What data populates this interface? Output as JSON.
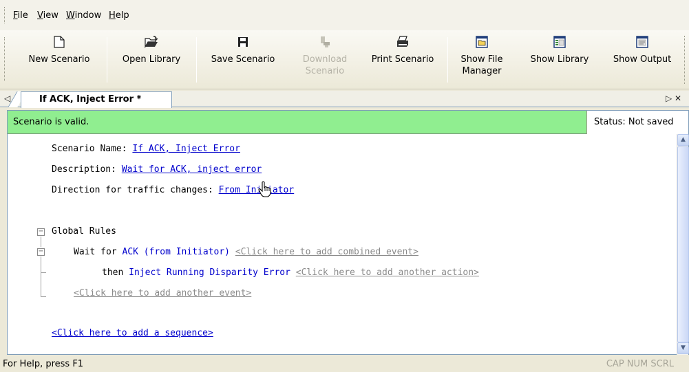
{
  "menu": {
    "items": [
      {
        "label": "File",
        "accel": "F",
        "rest": "ile"
      },
      {
        "label": "View",
        "accel": "V",
        "rest": "iew"
      },
      {
        "label": "Window",
        "accel": "W",
        "rest": "indow"
      },
      {
        "label": "Help",
        "accel": "H",
        "rest": "elp"
      }
    ]
  },
  "toolbar": {
    "new_scenario": {
      "line1": "New Scenario",
      "icon": "new-document-icon"
    },
    "open_library": {
      "line1": "Open Library",
      "icon": "open-folder-icon"
    },
    "save_scenario": {
      "line1": "Save Scenario",
      "icon": "floppy-disk-icon"
    },
    "download_scenario": {
      "line1": "Download",
      "line2": "Scenario",
      "icon": "download-icon",
      "enabled": false
    },
    "print_scenario": {
      "line1": "Print Scenario",
      "icon": "printer-icon"
    },
    "show_file_manager": {
      "line1": "Show File",
      "line2": "Manager",
      "icon": "file-manager-icon"
    },
    "show_library": {
      "line1": "Show Library",
      "icon": "library-icon"
    },
    "show_output": {
      "line1": "Show Output",
      "icon": "output-window-icon"
    }
  },
  "tabs": {
    "left_arrow": "◁",
    "right_arrows": "▷ ✕",
    "active_tab": "If ACK, Inject Error *"
  },
  "validation": {
    "message": "Scenario is valid.",
    "status": "Status: Not saved",
    "color": "#90ee90"
  },
  "editor": {
    "scenario_name_label": "Scenario Name:",
    "scenario_name_value": "If ACK, Inject Error",
    "description_label": "Description:",
    "description_value": "Wait for ACK, inject error",
    "direction_label": "Direction for traffic changes:",
    "direction_value": "From Initiator",
    "global_rules_label": "Global Rules",
    "wait_for_label": "Wait for",
    "wait_for_event": "ACK (from Initiator)",
    "add_combined_event": "<Click here to add combined event>",
    "then_label": "then",
    "action": "Inject Running Disparity Error",
    "add_another_action": "<Click here to add another action>",
    "add_another_event": "<Click here to add another event>",
    "add_sequence": "<Click here to add a sequence>"
  },
  "statusbar": {
    "help": "For Help, press F1",
    "keys": "CAP  NUM  SCRL"
  }
}
